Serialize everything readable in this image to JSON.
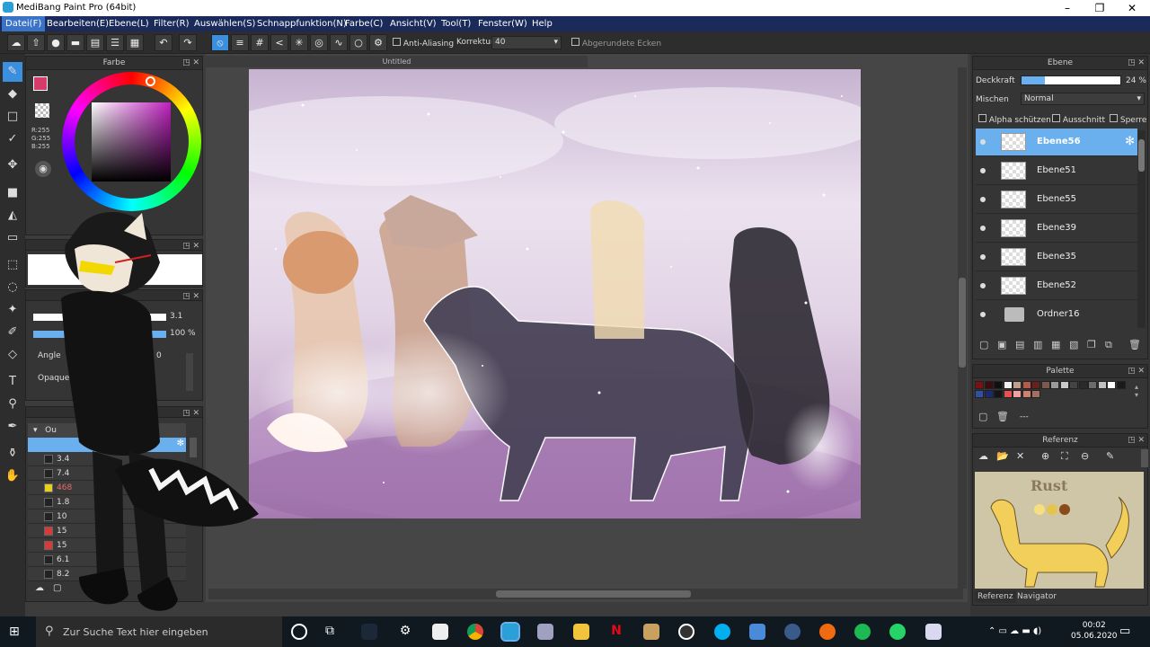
{
  "window": {
    "title": "MediBang Paint Pro (64bit)"
  },
  "menus": [
    "Datei(F)",
    "Bearbeiten(E)",
    "Ebene(L)",
    "Filter(R)",
    "Auswählen(S)",
    "Schnappfunktion(N)",
    "Farbe(C)",
    "Ansicht(V)",
    "Tool(T)",
    "Fenster(W)",
    "Help"
  ],
  "toolbar": {
    "anti_aliasing": "Anti-Aliasing",
    "korrektur_label": "Korrektur",
    "korrektur_value": "40",
    "rounded_corners": "Abgerundete Ecken"
  },
  "color_panel": {
    "title": "Farbe",
    "r": "R:255",
    "g": "G:255",
    "b": "B:255"
  },
  "brush_panel": {
    "size": "3.1",
    "opacity": "100 %",
    "angle": "Angle",
    "opaque": "Opaque",
    "angle_value": "0"
  },
  "brush_list": {
    "header": "Ou",
    "items": [
      {
        "size": "3.4",
        "color": "#222222"
      },
      {
        "size": "7.4",
        "color": "#222222"
      },
      {
        "size": "468",
        "color": "#e6d21a"
      },
      {
        "size": "1.8",
        "color": "#222222"
      },
      {
        "size": "10",
        "color": "#222222"
      },
      {
        "size": "15",
        "color": "#d83a3a"
      },
      {
        "size": "15",
        "color": "#d83a3a"
      },
      {
        "size": "6.1",
        "color": "#222222"
      },
      {
        "size": "8.2",
        "color": "#222222"
      }
    ]
  },
  "canvas": {
    "doc_title": "Untitled"
  },
  "layer_panel": {
    "title": "Ebene",
    "opacity_label": "Deckkraft",
    "opacity_value": "24 %",
    "opacity_fraction": 0.24,
    "blend_label": "Mischen",
    "blend_value": "Normal",
    "alpha_protect": "Alpha schützen",
    "clipping": "Ausschnitt",
    "lock": "Sperre",
    "layers": [
      "Ebene56",
      "Ebene51",
      "Ebene55",
      "Ebene39",
      "Ebene35",
      "Ebene52",
      "Ordner16"
    ]
  },
  "palette_panel": {
    "title": "Palette",
    "placeholder": "---",
    "colors": [
      "#7a1212",
      "#3a0e0e",
      "#101010",
      "#f2f2f2",
      "#c0a08a",
      "#b45a48",
      "#6b2020",
      "#7c5a50",
      "#9a9a9a",
      "#c8c8c8",
      "#444444",
      "#2a2a2a",
      "#6b6b6b",
      "#bfbfbf",
      "#ffffff",
      "#1a1a1a",
      "#3050a0",
      "#1a2a70",
      "#151515",
      "#e85050",
      "#f0a0a0",
      "#d08070",
      "#a07060"
    ]
  },
  "reference_panel": {
    "title": "Referenz",
    "image_text": "Rust",
    "tab_reference": "Referenz",
    "tab_navigator": "Navigator"
  },
  "taskbar": {
    "search_placeholder": "Zur Suche Text hier eingeben",
    "time": "00:02",
    "date": "05.06.2020"
  },
  "colors": {
    "accent": "#3a8fde",
    "menubar": "#1a2a5a",
    "selected_layer": "#6ab0ee"
  }
}
